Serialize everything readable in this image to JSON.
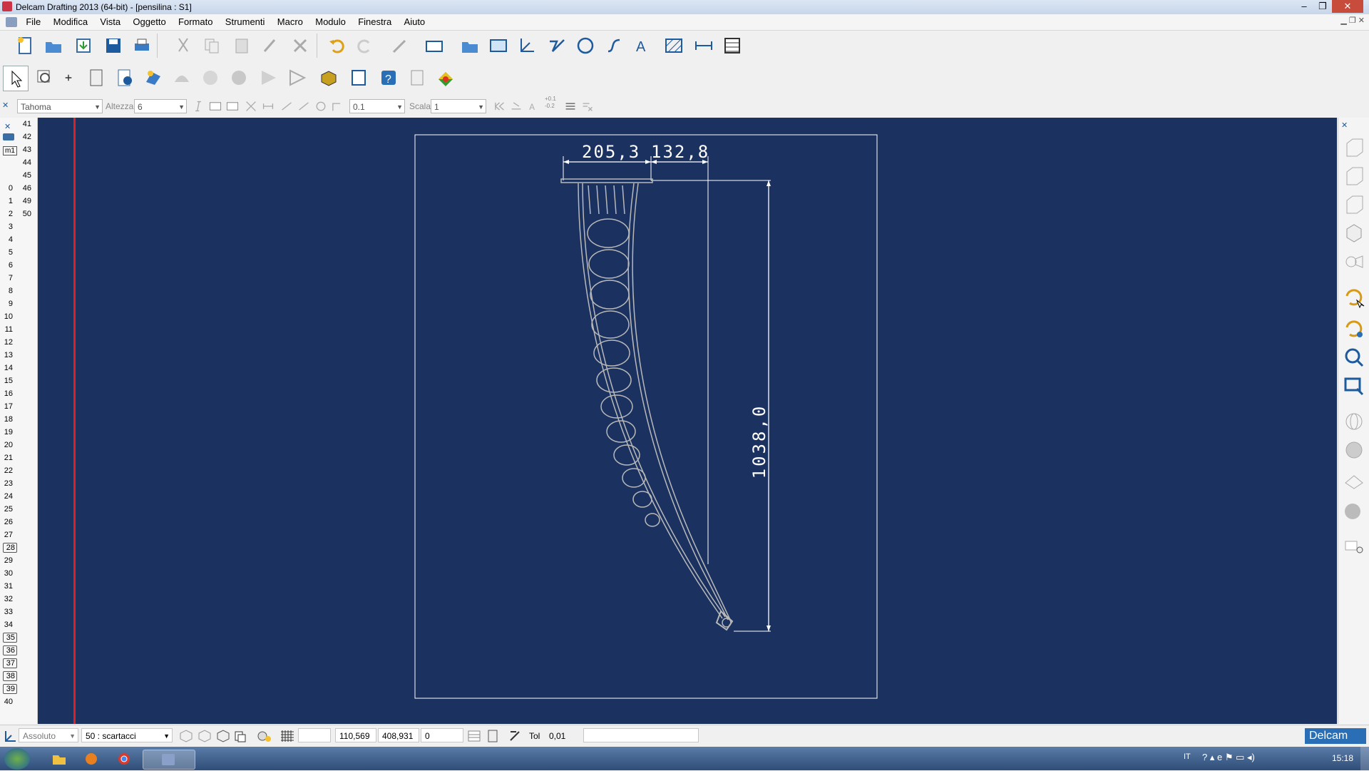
{
  "window": {
    "title": "Delcam Drafting 2013 (64-bit) - [pensilina : S1]",
    "min": "–",
    "max": "❐",
    "close": "✕"
  },
  "menu": [
    "File",
    "Modifica",
    "Vista",
    "Oggetto",
    "Formato",
    "Strumenti",
    "Macro",
    "Modulo",
    "Finestra",
    "Aiuto"
  ],
  "toolbar1_icons": [
    "new-icon",
    "open-icon",
    "import-icon",
    "save-icon",
    "print-icon",
    "cut-icon",
    "copy-icon",
    "paste-icon",
    "brush-icon",
    "delete-icon",
    "undo-icon",
    "redo-icon",
    "pen-icon",
    "layer-icon",
    "open-folder-icon",
    "panel-icon",
    "axis-icon",
    "polyline-icon",
    "circle-icon",
    "curve-icon",
    "text-icon",
    "hatch-icon",
    "dimension-icon",
    "table-icon"
  ],
  "toolbar2_icons": [
    "select-arrow-icon",
    "zoom-window-icon",
    "pin-icon",
    "calculator-icon",
    "info-icon",
    "wizard-icon",
    "shape-icon",
    "sphere-icon",
    "ball-icon",
    "cone-icon",
    "shade-icon",
    "box-icon",
    "frame-icon",
    "help-icon",
    "clipboard-icon",
    "colorize-icon"
  ],
  "format_bar": {
    "font": "Tahoma",
    "height_label": "Altezza",
    "height_value": "6",
    "spacing_value": "0.1",
    "scale_label": "Scala",
    "scale_value": "1",
    "tolerance_label": "+0.1\n-0.2"
  },
  "left_panel": {
    "col1": [
      "0",
      "1",
      "2",
      "3",
      "4",
      "5",
      "6",
      "7",
      "8",
      "9",
      "10",
      "11",
      "12",
      "13",
      "14",
      "15",
      "16",
      "17",
      "18",
      "19",
      "20",
      "21",
      "22",
      "23",
      "24",
      "25",
      "26",
      "27",
      "28",
      "29",
      "30",
      "31",
      "32",
      "33",
      "34",
      "35",
      "36",
      "37",
      "38",
      "39",
      "40"
    ],
    "col2": [
      "41",
      "42",
      "43",
      "44",
      "45",
      "46",
      "49",
      "50"
    ],
    "boxed": [
      "28",
      "35",
      "36",
      "37",
      "38",
      "39"
    ],
    "icon_label": "m1"
  },
  "drawing": {
    "dim_width": "205,3",
    "dim_offset": "132,8",
    "dim_height": "1038,0"
  },
  "status": {
    "mode": "Assoluto",
    "layer": "50 : scartacci",
    "coord_x": "110,569",
    "coord_y": "408,931",
    "coord_z": "0",
    "tol_label": "Tol",
    "tol_value": "0,01",
    "brand": "Delcam"
  },
  "taskbar": {
    "lang": "IT",
    "clock": "15:18"
  },
  "colors": {
    "canvas": "#1b3261",
    "accent_red": "#e02020",
    "brand": "#2a6fb5"
  }
}
